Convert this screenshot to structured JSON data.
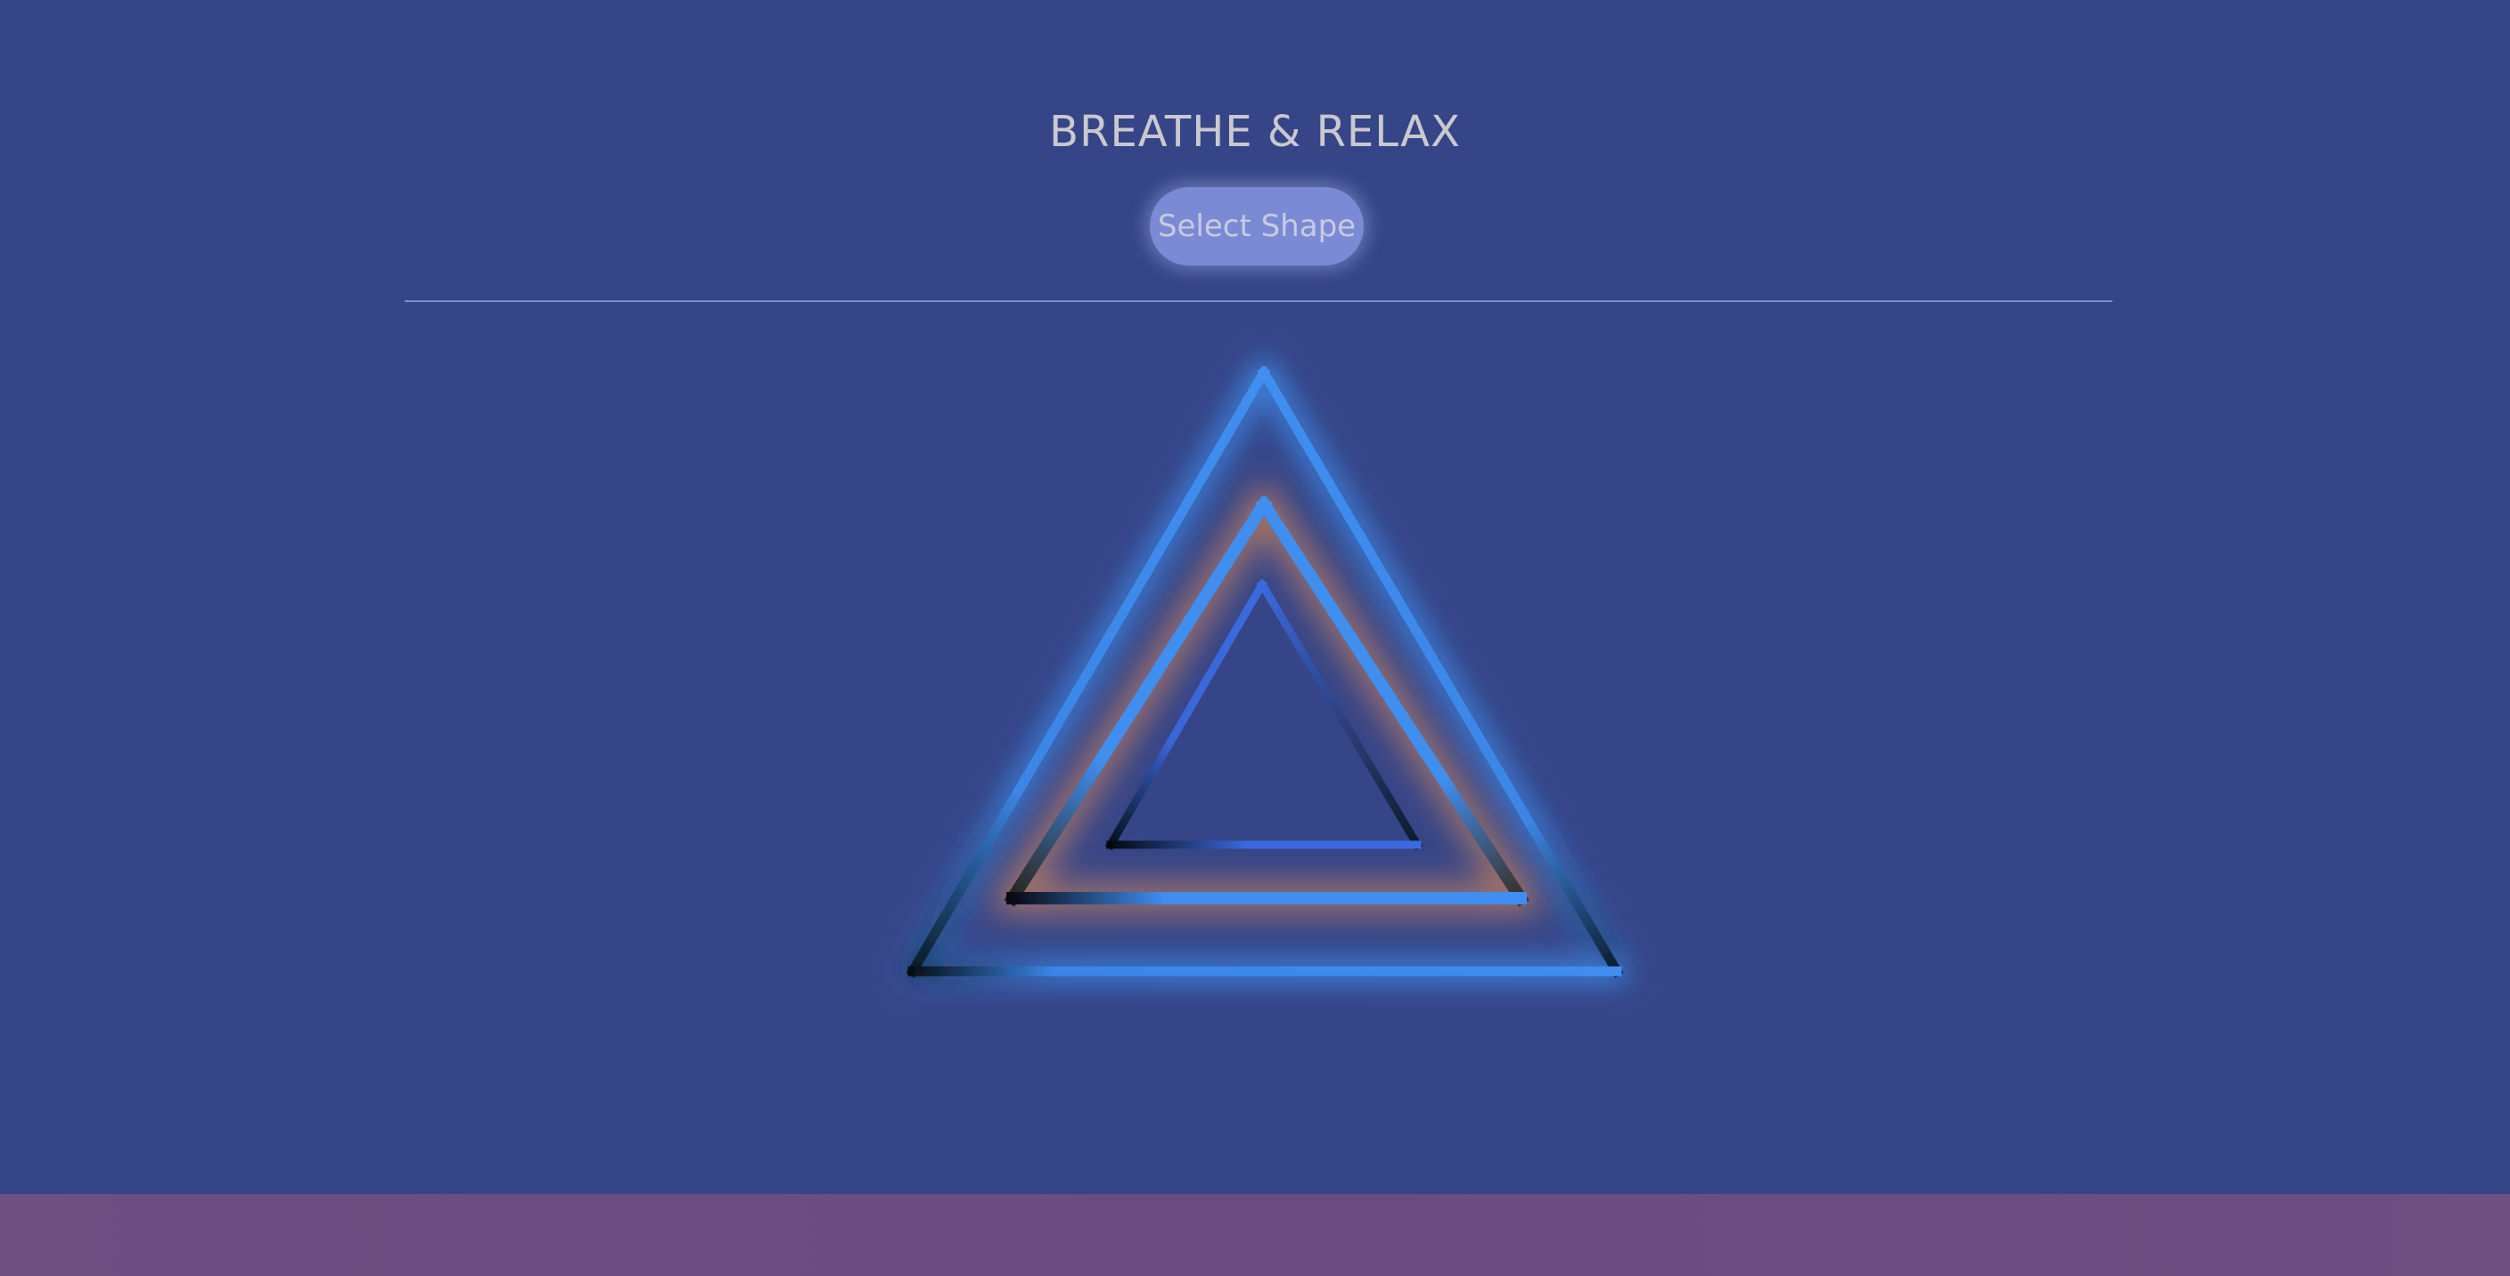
{
  "header": {
    "title": "BREATHE & RELAX",
    "select_shape_label": "Select Shape"
  },
  "shape": {
    "name": "triangle",
    "rings": 3
  },
  "colors": {
    "background": "#364587",
    "accent_blue": "#3f86e6",
    "glow_orange": "#d8895a",
    "footer": "#6e4f82",
    "button": "#7a8ad4"
  }
}
